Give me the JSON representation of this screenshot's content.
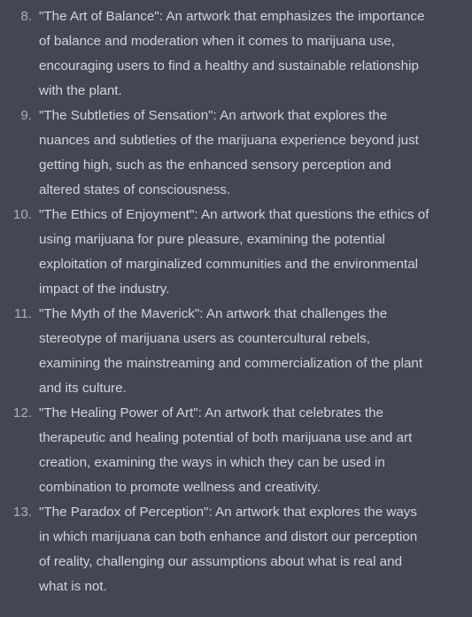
{
  "colors": {
    "background": "#444654",
    "text": "#d1d5db",
    "number": "#acacbe"
  },
  "items": [
    {
      "number": "8.",
      "text": "\"The Art of Balance\": An artwork that emphasizes the importance of balance and moderation when it comes to marijuana use, encouraging users to find a healthy and sustainable relationship with the plant."
    },
    {
      "number": "9.",
      "text": "\"The Subtleties of Sensation\": An artwork that explores the nuances and subtleties of the marijuana experience beyond just getting high, such as the enhanced sensory perception and altered states of consciousness."
    },
    {
      "number": "10.",
      "text": "\"The Ethics of Enjoyment\": An artwork that questions the ethics of using marijuana for pure pleasure, examining the potential exploitation of marginalized communities and the environmental impact of the industry."
    },
    {
      "number": "11.",
      "text": "\"The Myth of the Maverick\": An artwork that challenges the stereotype of marijuana users as countercultural rebels, examining the mainstreaming and commercialization of the plant and its culture."
    },
    {
      "number": "12.",
      "text": "\"The Healing Power of Art\": An artwork that celebrates the therapeutic and healing potential of both marijuana use and art creation, examining the ways in which they can be used in combination to promote wellness and creativity."
    },
    {
      "number": "13.",
      "text": "\"The Paradox of Perception\": An artwork that explores the ways in which marijuana can both enhance and distort our perception of reality, challenging our assumptions about what is real and what is not."
    }
  ]
}
